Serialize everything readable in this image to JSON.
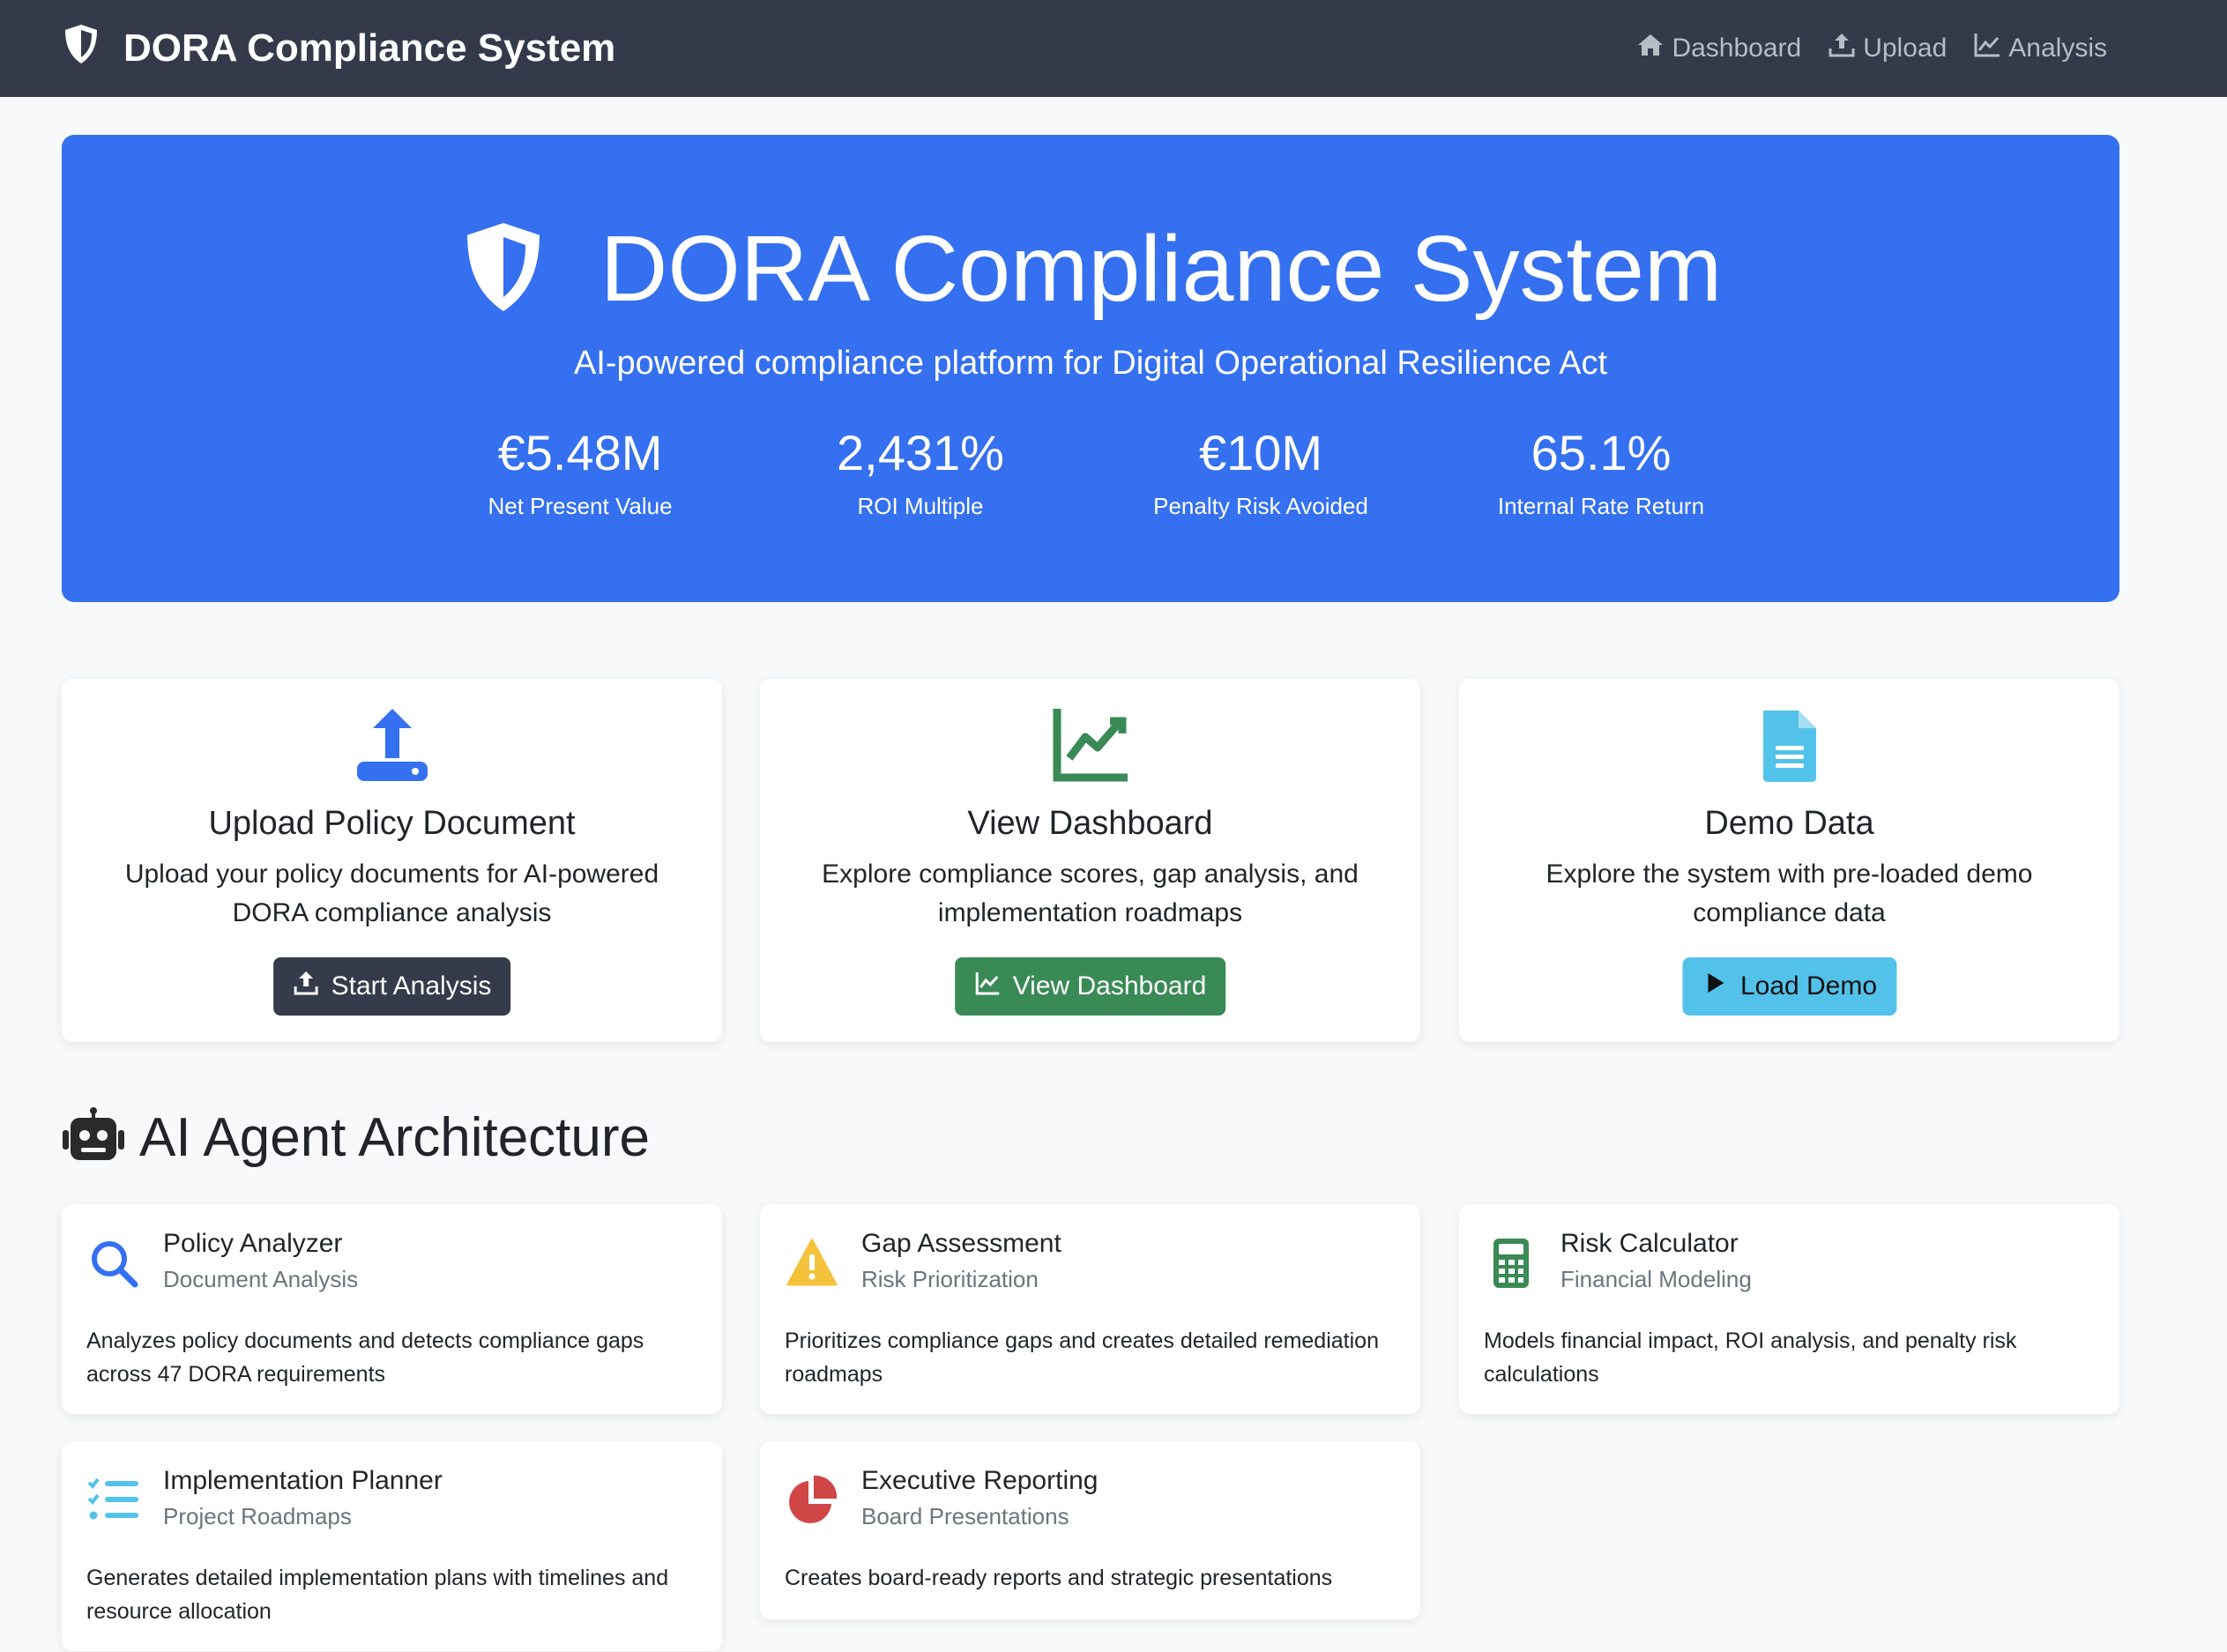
{
  "navbar": {
    "brand": "DORA Compliance System",
    "links": [
      {
        "label": "Dashboard",
        "icon": "home-icon"
      },
      {
        "label": "Upload",
        "icon": "upload-icon"
      },
      {
        "label": "Analysis",
        "icon": "chart-line-icon"
      }
    ]
  },
  "hero": {
    "title": "DORA Compliance System",
    "subtitle": "AI-powered compliance platform for Digital Operational Resilience Act",
    "stats": [
      {
        "value": "€5.48M",
        "label": "Net Present Value"
      },
      {
        "value": "2,431%",
        "label": "ROI Multiple"
      },
      {
        "value": "€10M",
        "label": "Penalty Risk Avoided"
      },
      {
        "value": "65.1%",
        "label": "Internal Rate Return"
      }
    ]
  },
  "features": [
    {
      "title": "Upload Policy Document",
      "text": "Upload your policy documents for AI-powered DORA compliance analysis",
      "button": "Start Analysis",
      "icon": "upload-icon",
      "color": "#3470f0"
    },
    {
      "title": "View Dashboard",
      "text": "Explore compliance scores, gap analysis, and implementation roadmaps",
      "button": "View Dashboard",
      "icon": "chart-line-icon",
      "color": "#3a8a56"
    },
    {
      "title": "Demo Data",
      "text": "Explore the system with pre-loaded demo compliance data",
      "button": "Load Demo",
      "icon": "file-alt-icon",
      "color": "#53c2ea"
    }
  ],
  "architecture": {
    "title": "AI Agent Architecture",
    "agents": [
      {
        "title": "Policy Analyzer",
        "subtitle": "Document Analysis",
        "text": "Analyzes policy documents and detects compliance gaps across 47 DORA requirements",
        "icon": "search-icon",
        "color": "#3470f0"
      },
      {
        "title": "Gap Assessment",
        "subtitle": "Risk Prioritization",
        "text": "Prioritizes compliance gaps and creates detailed remediation roadmaps",
        "icon": "warning-icon",
        "color": "#f5c23c"
      },
      {
        "title": "Risk Calculator",
        "subtitle": "Financial Modeling",
        "text": "Models financial impact, ROI analysis, and penalty risk calculations",
        "icon": "calculator-icon",
        "color": "#3a8a56"
      },
      {
        "title": "Implementation Planner",
        "subtitle": "Project Roadmaps",
        "text": "Generates detailed implementation plans with timelines and resource allocation",
        "icon": "tasks-icon",
        "color": "#53c2ea"
      },
      {
        "title": "Executive Reporting",
        "subtitle": "Board Presentations",
        "text": "Creates board-ready reports and strategic presentations",
        "icon": "pie-chart-icon",
        "color": "#d04545"
      }
    ]
  }
}
